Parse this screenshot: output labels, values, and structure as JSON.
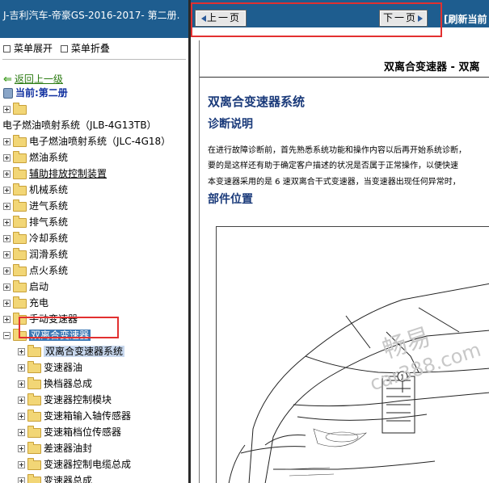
{
  "left": {
    "title": "J-吉利汽车-帝豪GS-2016-2017- 第二册.",
    "toolbar": {
      "expand": "菜单展开",
      "collapse": "菜单折叠"
    },
    "back": "返回上一级",
    "current": "当前:第二册",
    "tree": [
      {
        "label": "",
        "sign": "plus",
        "indent": 0
      },
      {
        "label": "电子燃油喷射系统（JLB-4G13TB）",
        "sign": "none",
        "indent": -1
      },
      {
        "label": "电子燃油喷射系统（JLC-4G18）",
        "sign": "plus",
        "indent": 0
      },
      {
        "label": "燃油系统",
        "sign": "plus",
        "indent": 0
      },
      {
        "label": "辅助排放控制装置",
        "sign": "plus",
        "indent": 0,
        "style": "ul"
      },
      {
        "label": "机械系统",
        "sign": "plus",
        "indent": 0
      },
      {
        "label": "进气系统",
        "sign": "plus",
        "indent": 0
      },
      {
        "label": "排气系统",
        "sign": "plus",
        "indent": 0
      },
      {
        "label": "冷却系统",
        "sign": "plus",
        "indent": 0
      },
      {
        "label": "润滑系统",
        "sign": "plus",
        "indent": 0
      },
      {
        "label": "点火系统",
        "sign": "plus",
        "indent": 0
      },
      {
        "label": "启动",
        "sign": "plus",
        "indent": 0
      },
      {
        "label": "充电",
        "sign": "plus",
        "indent": 0
      },
      {
        "label": "手动变速器",
        "sign": "plus",
        "indent": 0
      },
      {
        "label": "双离合变速器",
        "sign": "minus",
        "indent": 0,
        "style": "sel"
      },
      {
        "label": "双离合变速器系统",
        "sign": "plus",
        "indent": 1,
        "style": "sel2"
      },
      {
        "label": "变速器油",
        "sign": "plus",
        "indent": 1
      },
      {
        "label": "换档器总成",
        "sign": "plus",
        "indent": 1
      },
      {
        "label": "变速器控制模块",
        "sign": "plus",
        "indent": 1
      },
      {
        "label": "变速箱输入轴传感器",
        "sign": "plus",
        "indent": 1
      },
      {
        "label": "变速箱档位传感器",
        "sign": "plus",
        "indent": 1
      },
      {
        "label": "差速器油封",
        "sign": "plus",
        "indent": 1
      },
      {
        "label": "变速器控制电缆总成",
        "sign": "plus",
        "indent": 1
      },
      {
        "label": "变速器总成",
        "sign": "plus",
        "indent": 1
      }
    ]
  },
  "nav": {
    "prev": "上一页",
    "next": "下一页",
    "refresh": "[刷新当前"
  },
  "doc": {
    "header": "双离合变速器 - 双离",
    "title": "双离合变速器系统",
    "section1": "诊断说明",
    "para1": "在进行故障诊断前，首先熟悉系统功能和操作内容以后再开始系统诊断，",
    "para2": "要的是这样还有助于确定客户描述的状况是否属于正常操作，以便快速",
    "para3": "本变速器采用的是 6 速双离合干式变速器，当变速器出现任何异常时，",
    "section2": "部件位置",
    "figure_label": "1"
  },
  "watermark": {
    "text1": "畅易",
    "text2": "car388.com"
  },
  "colors": {
    "titlebar": "#1e5d8f",
    "highlight": "#e23030",
    "doc_heading": "#1a3a7a"
  }
}
